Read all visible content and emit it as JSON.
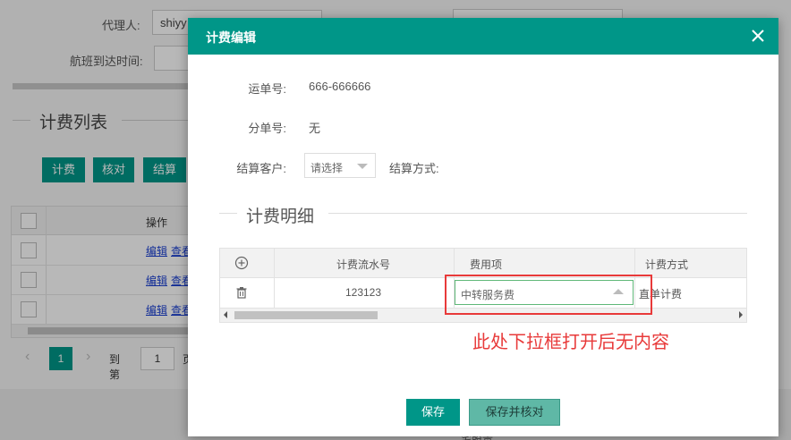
{
  "background": {
    "agent_label": "代理人:",
    "agent_value": "shiyy",
    "arrival_label": "航班到达时间:",
    "list_title": "计费列表",
    "buttons": [
      "计费",
      "核对",
      "结算"
    ],
    "table_header_op": "操作",
    "row_links": {
      "edit": "编辑",
      "view": "查看"
    },
    "pager": {
      "current": "1",
      "goto_label": "到第",
      "goto_value": "1",
      "trailing": "页"
    },
    "under_text": "宅股贵"
  },
  "modal": {
    "title": "计费编辑",
    "waybill_label": "运单号:",
    "waybill_value": "666-666666",
    "sub_label": "分单号:",
    "sub_value": "无",
    "customer_label": "结算客户:",
    "customer_placeholder": "请选择",
    "method_label": "结算方式:",
    "section_title": "计费明细",
    "grid": {
      "headers": [
        "计费流水号",
        "费用项",
        "计费方式"
      ],
      "row": {
        "serial": "123123",
        "fee_item": "中转服务费",
        "calc_method": "直单计费"
      }
    },
    "save_label": "保存",
    "save_check_label": "保存并核对"
  },
  "annotation": {
    "text": "此处下拉框打开后无内容",
    "color": "#e83a3a"
  },
  "colors": {
    "accent": "#009688",
    "annotation": "#e83a3a"
  }
}
